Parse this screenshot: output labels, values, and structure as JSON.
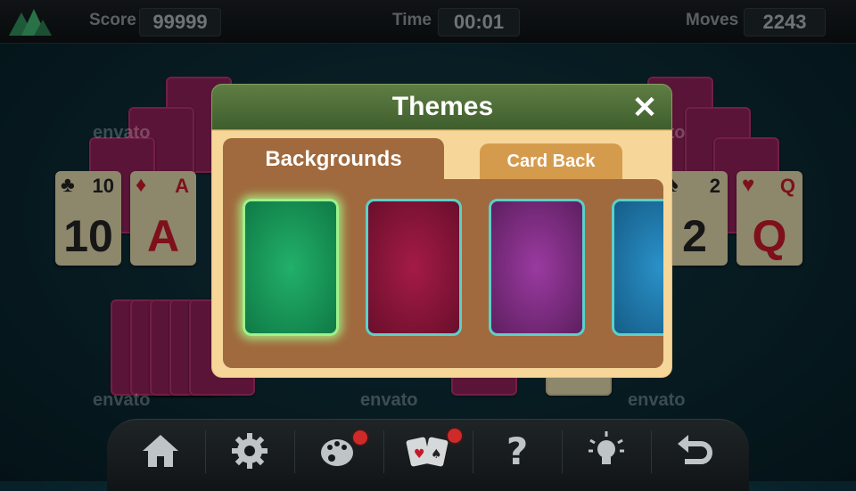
{
  "header": {
    "score_label": "Score",
    "score_value": "99999",
    "time_label": "Time",
    "time_value": "00:01",
    "moves_label": "Moves",
    "moves_value": "2243"
  },
  "watermark": "envato",
  "tableau_cards": [
    {
      "rank": "10",
      "suit": "♣",
      "color": "black"
    },
    {
      "rank": "A",
      "suit": "♦",
      "color": "red"
    },
    {
      "rank": "2",
      "suit": "♠",
      "color": "black"
    },
    {
      "rank": "Q",
      "suit": "♥",
      "color": "red"
    }
  ],
  "dialog": {
    "title": "Themes",
    "tabs": [
      {
        "label": "Backgrounds",
        "active": true
      },
      {
        "label": "Card Back",
        "active": false
      }
    ],
    "swatches": [
      {
        "name": "green",
        "color": "#1a9a5a",
        "selected": true
      },
      {
        "name": "crimson",
        "color": "#8a1538",
        "selected": false
      },
      {
        "name": "purple",
        "color": "#7e2b7e",
        "selected": false
      },
      {
        "name": "blue",
        "color": "#1f77a8",
        "selected": false
      }
    ]
  },
  "toolbar": {
    "icons": [
      "home-icon",
      "gear-icon",
      "palette-icon",
      "cards-icon",
      "help-icon",
      "hint-bulb-icon",
      "undo-icon"
    ]
  },
  "colors": {
    "accent_green": "#4e6f37",
    "panel_brown": "#a06a3e",
    "badge_red": "#cf2a2a"
  }
}
